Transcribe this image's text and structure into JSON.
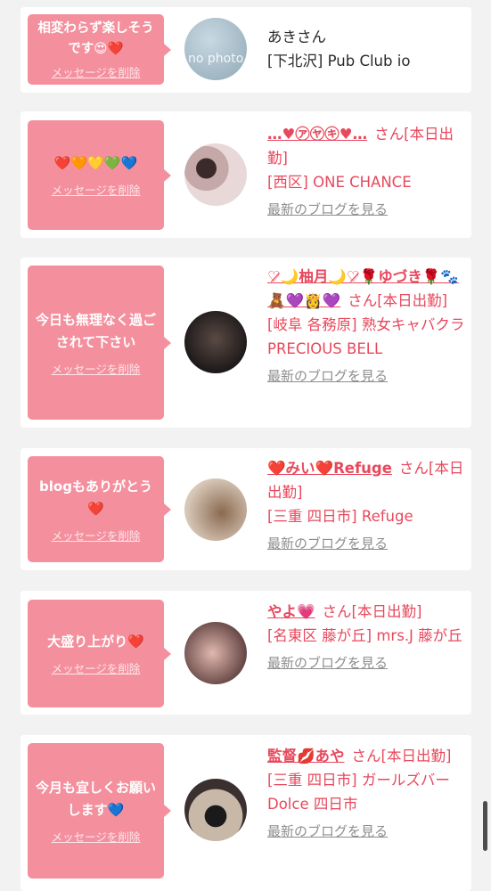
{
  "delete_label": "メッセージを削除",
  "blog_label": "最新のブログを見る",
  "accent_color": "#e8485c",
  "bubble_color": "#f4909e",
  "messages": [
    {
      "bubble_text": "相変わらず楽しそうです😍❤️",
      "avatar_text": "no photo",
      "name": "あきさん",
      "suffix": "",
      "shop": "[下北沢] Pub Club io"
    },
    {
      "bubble_text": "❤️🧡💛💚💙",
      "name": "…♥㋐㋳㋖♥…",
      "suffix": "さん[本日出勤]",
      "shop": "[西区] ONE CHANCE"
    },
    {
      "bubble_text": "今日も無理なく過ごされて下さい",
      "name": "♡̷🌙柚月🌙♡̷🌹ゆづき🌹🐾🧸💜👸💜",
      "suffix": "さん[本日出勤]",
      "shop": "[岐阜 各務原] 熟女キャバクラ PRECIOUS BELL"
    },
    {
      "bubble_text": "blogもありがとう❤️",
      "name": "❤️みい❤️Refuge",
      "suffix": "さん[本日出勤]",
      "shop": "[三重 四日市] Refuge"
    },
    {
      "bubble_text": "大盛り上がり❤️",
      "name": "やよ💗",
      "suffix": "さん[本日出勤]",
      "shop": "[名東区 藤が丘] mrs.J 藤が丘"
    },
    {
      "bubble_text": "今月も宜しくお願いします💙",
      "name": "監督💋あや",
      "suffix": "さん[本日出勤]",
      "shop": "[三重 四日市] ガールズバー Dolce 四日市"
    }
  ]
}
